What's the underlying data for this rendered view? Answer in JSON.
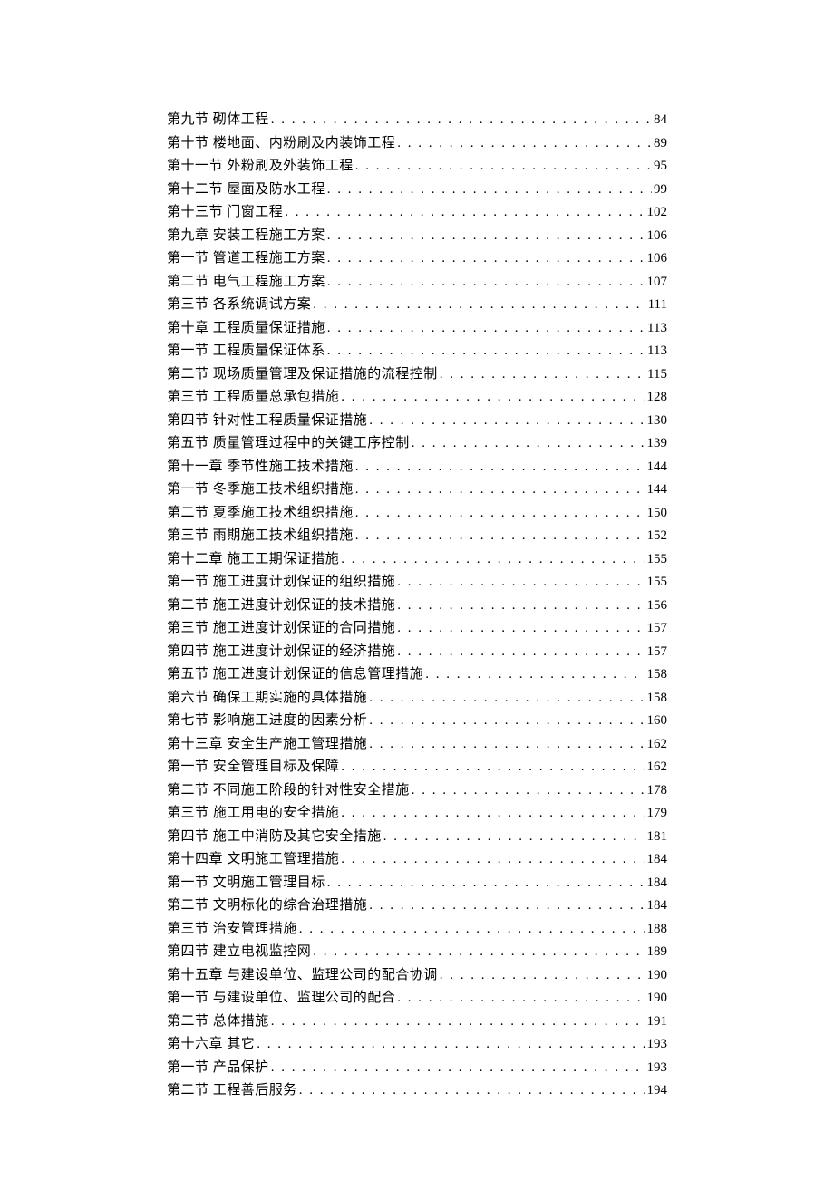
{
  "toc": [
    {
      "label": "第九节  砌体工程",
      "page": "84"
    },
    {
      "label": "第十节  楼地面、内粉刷及内装饰工程",
      "page": "89"
    },
    {
      "label": "第十一节  外粉刷及外装饰工程",
      "page": "95"
    },
    {
      "label": "第十二节  屋面及防水工程",
      "page": "99"
    },
    {
      "label": "第十三节  门窗工程",
      "page": "102"
    },
    {
      "label": "第九章  安装工程施工方案",
      "page": "106"
    },
    {
      "label": "第一节  管道工程施工方案",
      "page": "106"
    },
    {
      "label": "第二节  电气工程施工方案",
      "page": "107"
    },
    {
      "label": "第三节  各系统调试方案",
      "page": "111"
    },
    {
      "label": "第十章  工程质量保证措施",
      "page": "113"
    },
    {
      "label": "第一节  工程质量保证体系",
      "page": "113"
    },
    {
      "label": "第二节  现场质量管理及保证措施的流程控制",
      "page": "115"
    },
    {
      "label": "第三节  工程质量总承包措施",
      "page": "128"
    },
    {
      "label": "第四节  针对性工程质量保证措施",
      "page": "130"
    },
    {
      "label": "第五节 质量管理过程中的关键工序控制",
      "page": "139"
    },
    {
      "label": "第十一章  季节性施工技术措施",
      "page": "144"
    },
    {
      "label": "第一节  冬季施工技术组织措施",
      "page": "144"
    },
    {
      "label": "第二节  夏季施工技术组织措施",
      "page": "150"
    },
    {
      "label": "第三节  雨期施工技术组织措施",
      "page": "152"
    },
    {
      "label": "第十二章  施工工期保证措施",
      "page": "155"
    },
    {
      "label": "第一节  施工进度计划保证的组织措施",
      "page": "155"
    },
    {
      "label": "第二节  施工进度计划保证的技术措施",
      "page": "156"
    },
    {
      "label": "第三节  施工进度计划保证的合同措施",
      "page": "157"
    },
    {
      "label": "第四节  施工进度计划保证的经济措施",
      "page": "157"
    },
    {
      "label": "第五节  施工进度计划保证的信息管理措施",
      "page": "158"
    },
    {
      "label": "第六节  确保工期实施的具体措施",
      "page": "158"
    },
    {
      "label": "第七节  影响施工进度的因素分析",
      "page": "160"
    },
    {
      "label": "第十三章  安全生产施工管理措施",
      "page": "162"
    },
    {
      "label": "第一节  安全管理目标及保障",
      "page": "162"
    },
    {
      "label": "第二节  不同施工阶段的针对性安全措施",
      "page": "178"
    },
    {
      "label": "第三节  施工用电的安全措施",
      "page": "179"
    },
    {
      "label": "第四节  施工中消防及其它安全措施",
      "page": "181"
    },
    {
      "label": "第十四章  文明施工管理措施",
      "page": "184"
    },
    {
      "label": "第一节  文明施工管理目标",
      "page": "184"
    },
    {
      "label": "第二节  文明标化的综合治理措施",
      "page": "184"
    },
    {
      "label": "第三节  治安管理措施",
      "page": "188"
    },
    {
      "label": "第四节  建立电视监控网",
      "page": "189"
    },
    {
      "label": "第十五章  与建设单位、监理公司的配合协调",
      "page": "190"
    },
    {
      "label": "第一节  与建设单位、监理公司的配合",
      "page": "190"
    },
    {
      "label": "第二节  总体措施",
      "page": "191"
    },
    {
      "label": "第十六章  其它",
      "page": "193"
    },
    {
      "label": "第一节  产品保护",
      "page": "193"
    },
    {
      "label": "第二节  工程善后服务",
      "page": "194"
    }
  ]
}
